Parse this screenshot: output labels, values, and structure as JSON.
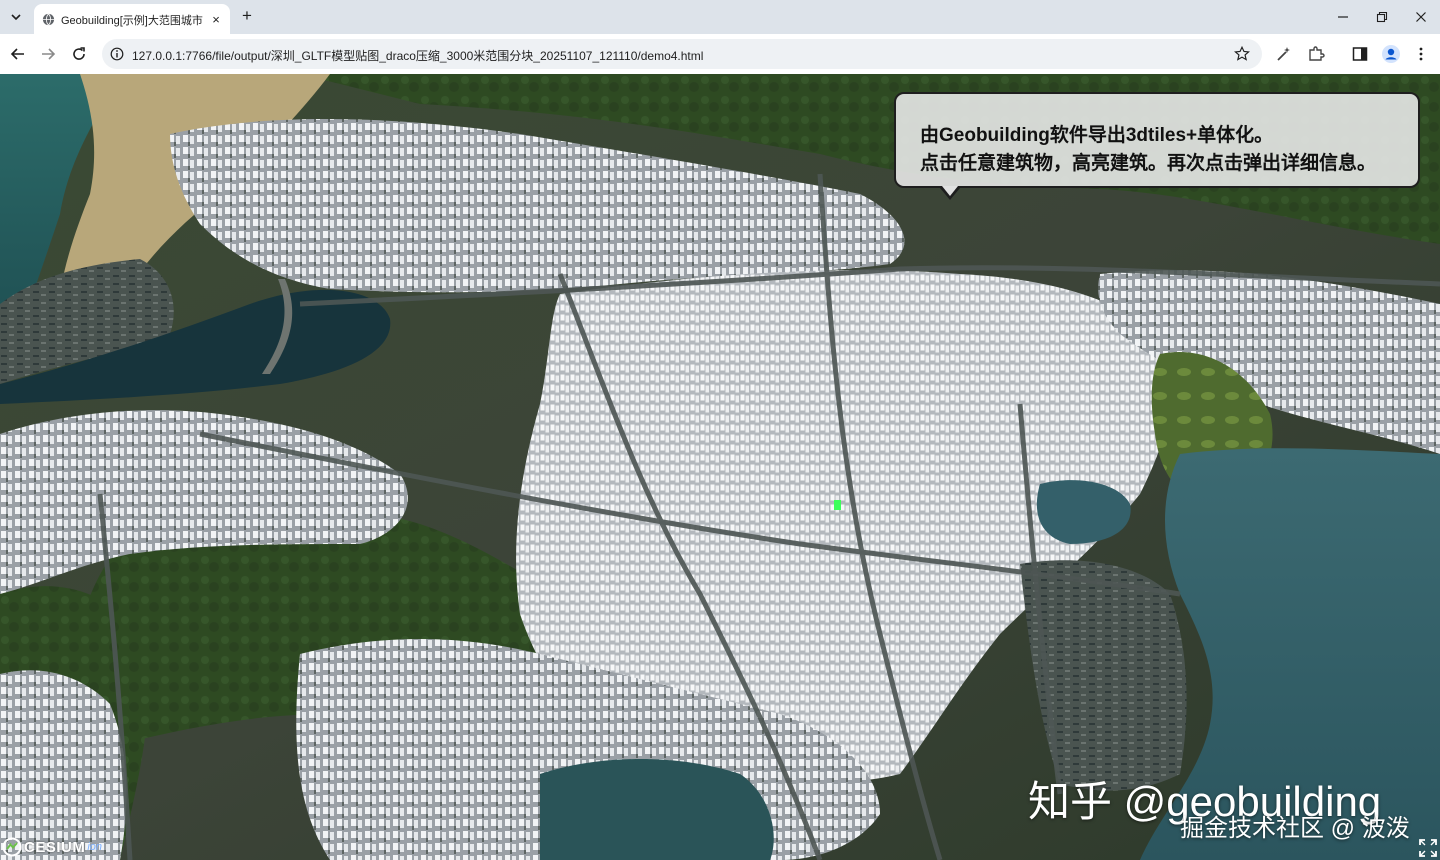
{
  "browser": {
    "tab_title": "Geobuilding[示例]大范围城市",
    "tab_close": "×",
    "new_tab": "+",
    "url": "127.0.0.1:7766/file/output/深圳_GLTF模型贴图_draco压缩_3000米范围分块_20251107_121110/demo4.html",
    "icons": {
      "tab_search": "chevron-down-icon",
      "favicon": "globe-icon",
      "minimize": "minimize-icon",
      "restore": "restore-icon",
      "close": "close-icon",
      "back": "arrow-left-icon",
      "forward": "arrow-right-icon",
      "reload": "reload-icon",
      "site_info": "info-icon",
      "bookmark": "star-icon",
      "extension_wand": "magic-wand-icon",
      "extensions": "puzzle-icon",
      "side_panel": "side-panel-icon",
      "profile": "profile-icon",
      "menu": "kebab-menu-icon"
    }
  },
  "scene": {
    "callout": {
      "line1": "由Geobuilding软件导出3dtiles+单体化。",
      "line2": "点击任意建筑物，高亮建筑。再次点击弹出详细信息。"
    },
    "watermark_zhihu": "知乎 @geobuilding",
    "watermark_juejin": "掘金技术社区 @ 波泼",
    "cesium_logo": {
      "word": "CESIUM",
      "ion": "ion"
    },
    "colors": {
      "water": "#2f5a66",
      "forest": "#2f4a24",
      "building": "#e9ecef",
      "callout_border": "#1e1e1e"
    }
  }
}
